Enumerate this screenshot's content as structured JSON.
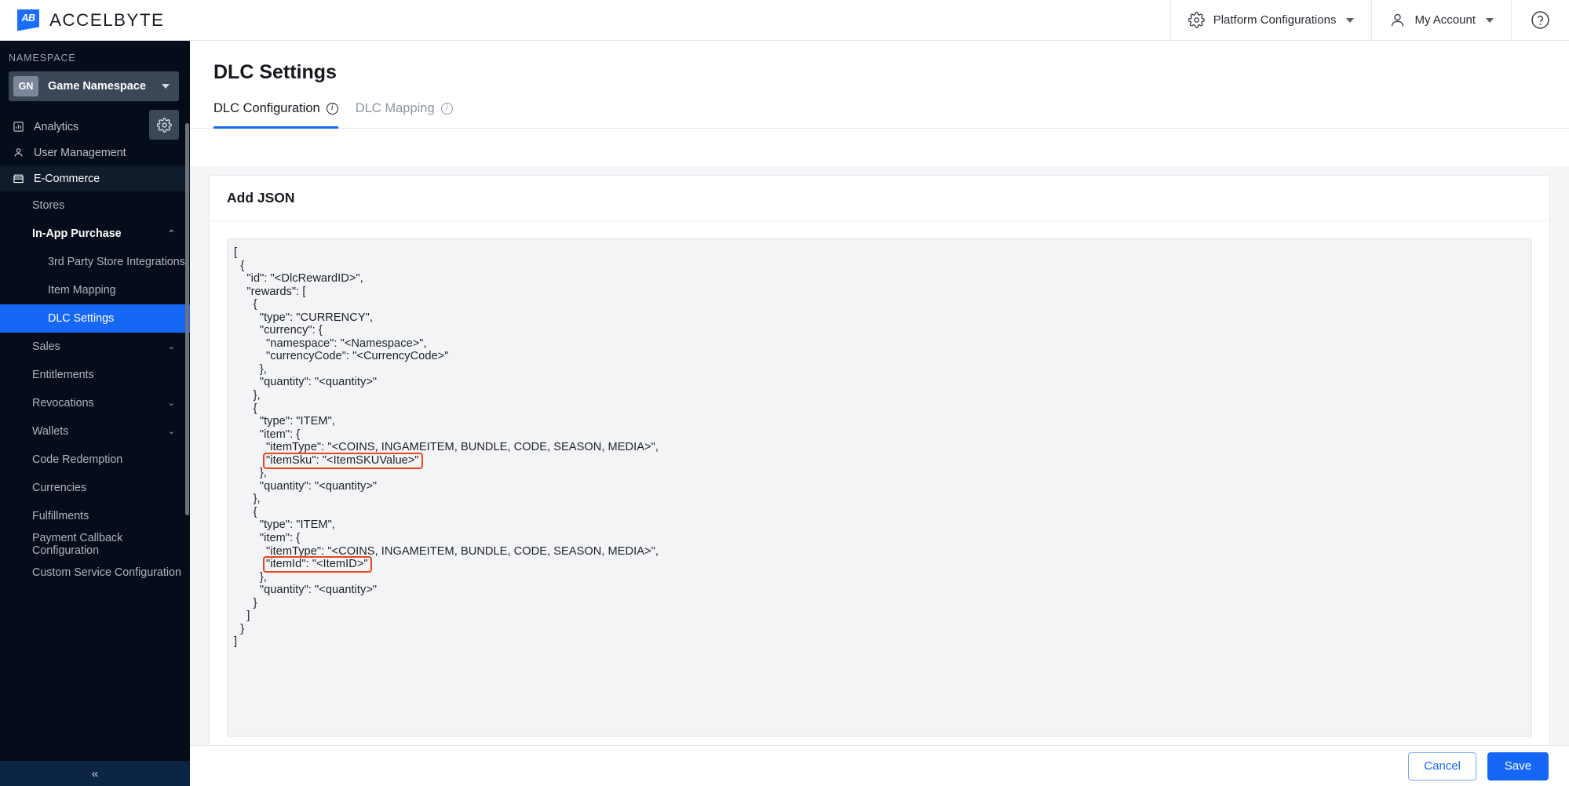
{
  "brand": {
    "mark": "AB",
    "name": "ACCELBYTE"
  },
  "topbar": {
    "platform_configs": "Platform Configurations",
    "my_account": "My Account",
    "help": "?"
  },
  "sidebar": {
    "namespace_label": "NAMESPACE",
    "namespace_badge": "GN",
    "namespace_name": "Game Namespace",
    "items": [
      {
        "label": "Analytics",
        "icon": "analytics-icon"
      },
      {
        "label": "User Management",
        "icon": "user-icon"
      },
      {
        "label": "E-Commerce",
        "icon": "store-icon"
      }
    ],
    "subitems": [
      {
        "label": "Stores"
      },
      {
        "label": "In-App Purchase",
        "caret": "⌃"
      },
      {
        "label": "3rd Party Store Integrations"
      },
      {
        "label": "Item Mapping"
      },
      {
        "label": "DLC Settings"
      },
      {
        "label": "Sales",
        "caret": "⌄"
      },
      {
        "label": "Entitlements"
      },
      {
        "label": "Revocations",
        "caret": "⌄"
      },
      {
        "label": "Wallets",
        "caret": "⌄"
      },
      {
        "label": "Code Redemption"
      },
      {
        "label": "Currencies"
      },
      {
        "label": "Fulfillments"
      },
      {
        "label": "Payment Callback Configuration"
      },
      {
        "label": "Custom Service Configuration"
      }
    ],
    "collapse": "«"
  },
  "main": {
    "title": "DLC Settings",
    "tabs": [
      {
        "label": "DLC Configuration",
        "info": "i"
      },
      {
        "label": "DLC Mapping",
        "info": "i"
      }
    ],
    "card_title": "Add JSON",
    "json_text": "[\n  {\n    \"id\": \"<DlcRewardID>\",\n    \"rewards\": [\n      {\n        \"type\": \"CURRENCY\",\n        \"currency\": {\n          \"namespace\": \"<Namespace>\",\n          \"currencyCode\": \"<CurrencyCode>\"\n        },\n        \"quantity\": \"<quantity>\"\n      },\n      {\n        \"type\": \"ITEM\",\n        \"item\": {\n          \"itemType\": \"<COINS, INGAMEITEM, BUNDLE, CODE, SEASON, MEDIA>\",\n          \"itemSku\": \"<ItemSKUValue>\"\n        },\n        \"quantity\": \"<quantity>\"\n      },\n      {\n        \"type\": \"ITEM\",\n        \"item\": {\n          \"itemType\": \"<COINS, INGAMEITEM, BUNDLE, CODE, SEASON, MEDIA>\",\n          \"itemId\": \"<ItemID>\"\n        },\n        \"quantity\": \"<quantity>\"\n      }\n    ]\n  }\n]",
    "highlights": [
      {
        "text": "\"itemSku\": \"<ItemSKUValue>\"",
        "color": "#f0431f"
      },
      {
        "text": "\"itemId\": \"<ItemID>\"",
        "color": "#f0431f"
      }
    ]
  },
  "footer": {
    "cancel": "Cancel",
    "save": "Save"
  },
  "colors": {
    "accent": "#1667f5",
    "sidebar_bg": "#060d1a",
    "highlight": "#f0431f",
    "canvas": "#f4f5f7"
  }
}
